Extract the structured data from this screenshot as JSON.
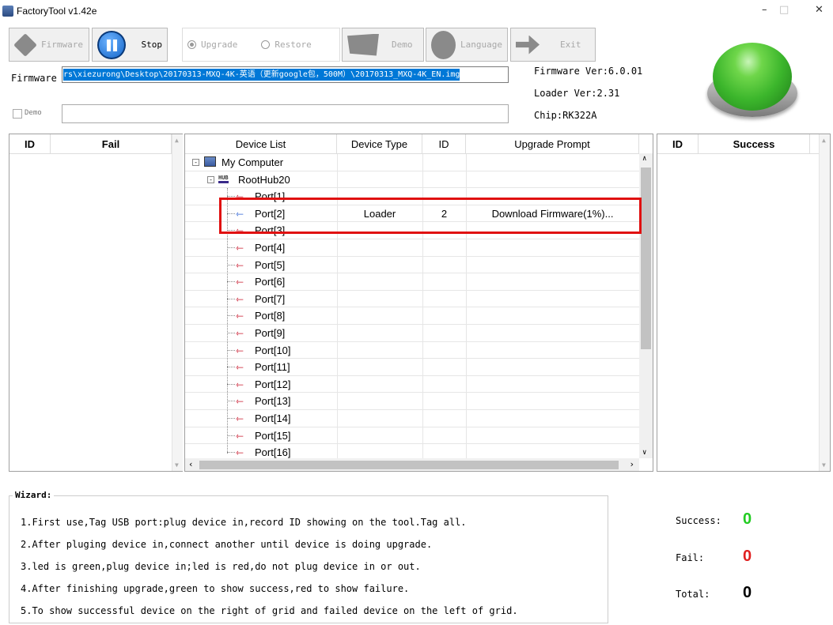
{
  "window": {
    "title": "FactoryTool v1.42e",
    "minimize": "–",
    "maximize": "□",
    "close": "✕"
  },
  "toolbar": {
    "firmware": "Firmware",
    "stop": "Stop",
    "upgrade": "Upgrade",
    "restore": "Restore",
    "demo": "Demo",
    "language": "Language",
    "exit": "Exit"
  },
  "firmware_row": {
    "label": "Firmware",
    "path": "rs\\xiezurong\\Desktop\\20170313-MXQ-4K-英语（更新google包，500M）\\20170313_MXQ-4K_EN.img"
  },
  "demo_row": {
    "label": "Demo",
    "value": ""
  },
  "info": {
    "firmware_ver": "Firmware Ver:6.0.01",
    "loader_ver": "Loader Ver:2.31",
    "chip": "Chip:RK322A"
  },
  "status_color": "#3cb62c",
  "fail_grid": {
    "id": "ID",
    "fail": "Fail"
  },
  "success_grid": {
    "id": "ID",
    "success": "Success"
  },
  "device_grid": {
    "headers": {
      "list": "Device List",
      "type": "Device Type",
      "id": "ID",
      "prompt": "Upgrade Prompt"
    },
    "computer": "My Computer",
    "hub": "RootHub20",
    "hub_icon": "HUB",
    "ports": [
      {
        "name": "Port[1]",
        "type": "",
        "id": "",
        "prompt": ""
      },
      {
        "name": "Port[2]",
        "type": "Loader",
        "id": "2",
        "prompt": "Download Firmware(1%)..."
      },
      {
        "name": "Port[3]",
        "type": "",
        "id": "",
        "prompt": ""
      },
      {
        "name": "Port[4]",
        "type": "",
        "id": "",
        "prompt": ""
      },
      {
        "name": "Port[5]",
        "type": "",
        "id": "",
        "prompt": ""
      },
      {
        "name": "Port[6]",
        "type": "",
        "id": "",
        "prompt": ""
      },
      {
        "name": "Port[7]",
        "type": "",
        "id": "",
        "prompt": ""
      },
      {
        "name": "Port[8]",
        "type": "",
        "id": "",
        "prompt": ""
      },
      {
        "name": "Port[9]",
        "type": "",
        "id": "",
        "prompt": ""
      },
      {
        "name": "Port[10]",
        "type": "",
        "id": "",
        "prompt": ""
      },
      {
        "name": "Port[11]",
        "type": "",
        "id": "",
        "prompt": ""
      },
      {
        "name": "Port[12]",
        "type": "",
        "id": "",
        "prompt": ""
      },
      {
        "name": "Port[13]",
        "type": "",
        "id": "",
        "prompt": ""
      },
      {
        "name": "Port[14]",
        "type": "",
        "id": "",
        "prompt": ""
      },
      {
        "name": "Port[15]",
        "type": "",
        "id": "",
        "prompt": ""
      },
      {
        "name": "Port[16]",
        "type": "",
        "id": "",
        "prompt": ""
      }
    ]
  },
  "wizard": {
    "title": "Wizard:",
    "lines": [
      "1.First use,Tag USB port:plug device in,record ID showing on the tool.Tag all.",
      "2.After pluging device in,connect another until device is doing upgrade.",
      "3.led is green,plug device in;led is red,do not plug device in or out.",
      "4.After finishing upgrade,green to show success,red to show failure.",
      "5.To show successful device on the right of grid and failed device on the left of grid."
    ]
  },
  "stats": {
    "success_label": "Success:",
    "success_value": "0",
    "success_color": "#22cc22",
    "fail_label": "Fail:",
    "fail_value": "0",
    "fail_color": "#e02020",
    "total_label": "Total:",
    "total_value": "0"
  },
  "colors": {
    "accent": "#0078d7",
    "highlight_box": "#e01010",
    "port_active": "#2a5fd6",
    "port_idle": "#c8142a"
  }
}
